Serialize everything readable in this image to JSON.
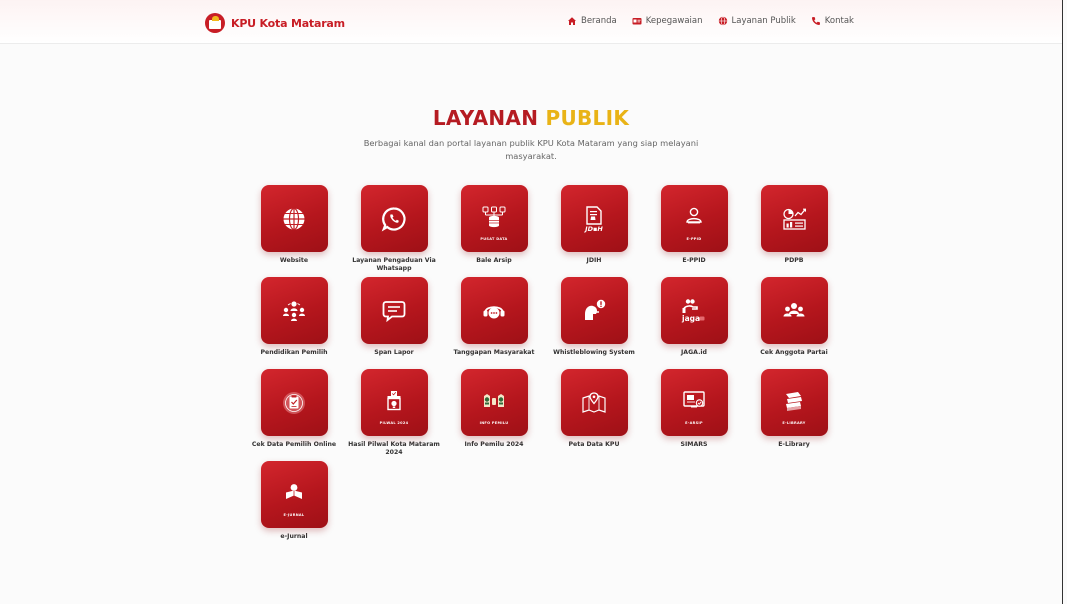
{
  "brand": {
    "name": "KPU Kota Mataram"
  },
  "nav": [
    {
      "label": "Beranda",
      "icon": "home-icon"
    },
    {
      "label": "Kepegawaian",
      "icon": "id-card-icon"
    },
    {
      "label": "Layanan Publik",
      "icon": "globe-icon"
    },
    {
      "label": "Kontak",
      "icon": "phone-icon"
    }
  ],
  "hero": {
    "title_part1": "LAYANAN",
    "title_part2": "PUBLIK",
    "subtitle": "Berbagai kanal dan portal layanan publik KPU Kota Mataram yang siap melayani masyarakat."
  },
  "services": [
    {
      "label": "Website",
      "icon": "globe-icon",
      "caption": ""
    },
    {
      "label": "Layanan Pengaduan Via Whatsapp",
      "icon": "whatsapp-icon",
      "caption": ""
    },
    {
      "label": "Bale Arsip",
      "icon": "archive-database-icon",
      "caption": "PUSAT DATA"
    },
    {
      "label": "JDIH",
      "icon": "jdih-document-icon",
      "caption": ""
    },
    {
      "label": "E-PPID",
      "icon": "eppid-user-icon",
      "caption": "E-PPID"
    },
    {
      "label": "PDPB",
      "icon": "pdpb-chart-icon",
      "caption": ""
    },
    {
      "label": "Pendidikan Pemilih",
      "icon": "people-network-icon",
      "caption": ""
    },
    {
      "label": "Span Lapor",
      "icon": "chat-icon",
      "caption": ""
    },
    {
      "label": "Tanggapan Masyarakat",
      "icon": "headset-icon",
      "caption": ""
    },
    {
      "label": "Whistleblowing System",
      "icon": "whistleblowing-icon",
      "caption": ""
    },
    {
      "label": "JAGA.id",
      "icon": "jaga-icon",
      "caption": ""
    },
    {
      "label": "Cek Anggota Partai",
      "icon": "group-icon",
      "caption": ""
    },
    {
      "label": "Cek Data Pemilih Online",
      "icon": "check-document-icon",
      "caption": ""
    },
    {
      "label": "Hasil Pilwal Kota Mataram 2024",
      "icon": "ballot-box-icon",
      "caption": "PILWAL 2024"
    },
    {
      "label": "Info Pemilu 2024",
      "icon": "mascot-icon",
      "caption": "INFO PEMILU"
    },
    {
      "label": "Peta Data KPU",
      "icon": "map-pin-icon",
      "caption": ""
    },
    {
      "label": "SIMARS",
      "icon": "e-arsip-icon",
      "caption": "E-ARSIP"
    },
    {
      "label": "E-Library",
      "icon": "books-icon",
      "caption": "E-LIBRARY"
    },
    {
      "label": "e-Jurnal",
      "icon": "reading-person-icon",
      "caption": "E-JURNAL"
    }
  ],
  "colors": {
    "brand_red": "#c81d25",
    "title_red": "#b51b22",
    "title_gold": "#e9b316",
    "tile_gradient_start": "#d3262d",
    "tile_gradient_end": "#9e1016"
  }
}
